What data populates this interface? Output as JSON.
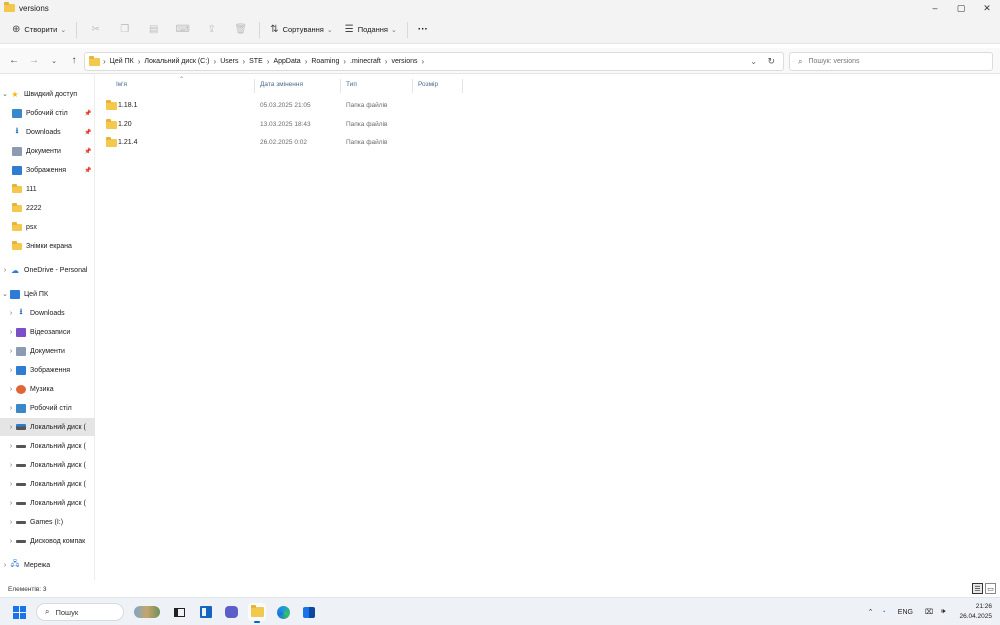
{
  "window": {
    "title": "versions",
    "controls": {
      "minimize": "–",
      "maximize": "▢",
      "close": "✕"
    }
  },
  "toolbar": {
    "new_label": "Створити",
    "sort_label": "Сортування",
    "view_label": "Подання",
    "more_label": "···"
  },
  "address": {
    "path": [
      "Цей ПК",
      "Локальний диск (C:)",
      "Users",
      "STE",
      "AppData",
      "Roaming",
      ".minecraft",
      "versions"
    ],
    "search_placeholder": "Пошук: versions"
  },
  "sidebar": {
    "quick_access": {
      "label": "Швидкий доступ",
      "items": [
        {
          "label": "Робочий стіл",
          "icon": "desktop-icon",
          "pinned": true
        },
        {
          "label": "Downloads",
          "icon": "download-icon",
          "pinned": true
        },
        {
          "label": "Документи",
          "icon": "documents-icon",
          "pinned": true
        },
        {
          "label": "Зображення",
          "icon": "pictures-icon",
          "pinned": true
        },
        {
          "label": "111",
          "icon": "folder-icon",
          "pinned": false
        },
        {
          "label": "2222",
          "icon": "folder-icon",
          "pinned": false
        },
        {
          "label": "psx",
          "icon": "folder-icon",
          "pinned": false
        },
        {
          "label": "Знімки екрана",
          "icon": "folder-icon",
          "pinned": false
        }
      ]
    },
    "onedrive": {
      "label": "OneDrive - Personal"
    },
    "this_pc": {
      "label": "Цей ПК",
      "items": [
        {
          "label": "Downloads",
          "icon": "download-icon"
        },
        {
          "label": "Відеозаписи",
          "icon": "videos-icon"
        },
        {
          "label": "Документи",
          "icon": "documents-icon"
        },
        {
          "label": "Зображення",
          "icon": "pictures-icon"
        },
        {
          "label": "Музика",
          "icon": "music-icon"
        },
        {
          "label": "Робочий стіл",
          "icon": "desktop-icon"
        },
        {
          "label": "Локальний диск (",
          "icon": "system-drive-icon"
        },
        {
          "label": "Локальний диск (",
          "icon": "drive-icon"
        },
        {
          "label": "Локальний диск (",
          "icon": "drive-icon"
        },
        {
          "label": "Локальний диск (",
          "icon": "drive-icon"
        },
        {
          "label": "Локальний диск (",
          "icon": "drive-icon"
        },
        {
          "label": "Games (I:)",
          "icon": "drive-icon"
        },
        {
          "label": "Дисковод компак",
          "icon": "drive-icon"
        }
      ]
    },
    "network": {
      "label": "Мережа"
    }
  },
  "columns": {
    "name": "Ім'я",
    "date": "Дата змінення",
    "type": "Тип",
    "size": "Розмір"
  },
  "files": [
    {
      "name": "1.18.1",
      "date": "05.03.2025 21:05",
      "type": "Папка файлів"
    },
    {
      "name": "1.20",
      "date": "13.03.2025 18:43",
      "type": "Папка файлів"
    },
    {
      "name": "1.21.4",
      "date": "26.02.2025 0:02",
      "type": "Папка файлів"
    }
  ],
  "status": {
    "count": "Елементів: 3"
  },
  "taskbar": {
    "search_label": "Пошук",
    "lang": "ENG",
    "time": "21:26",
    "date": "26.04.2025"
  },
  "colors": {
    "accent": "#0067c0",
    "folder": "#f2c94c",
    "selected_bg": "#e5e5e5"
  }
}
